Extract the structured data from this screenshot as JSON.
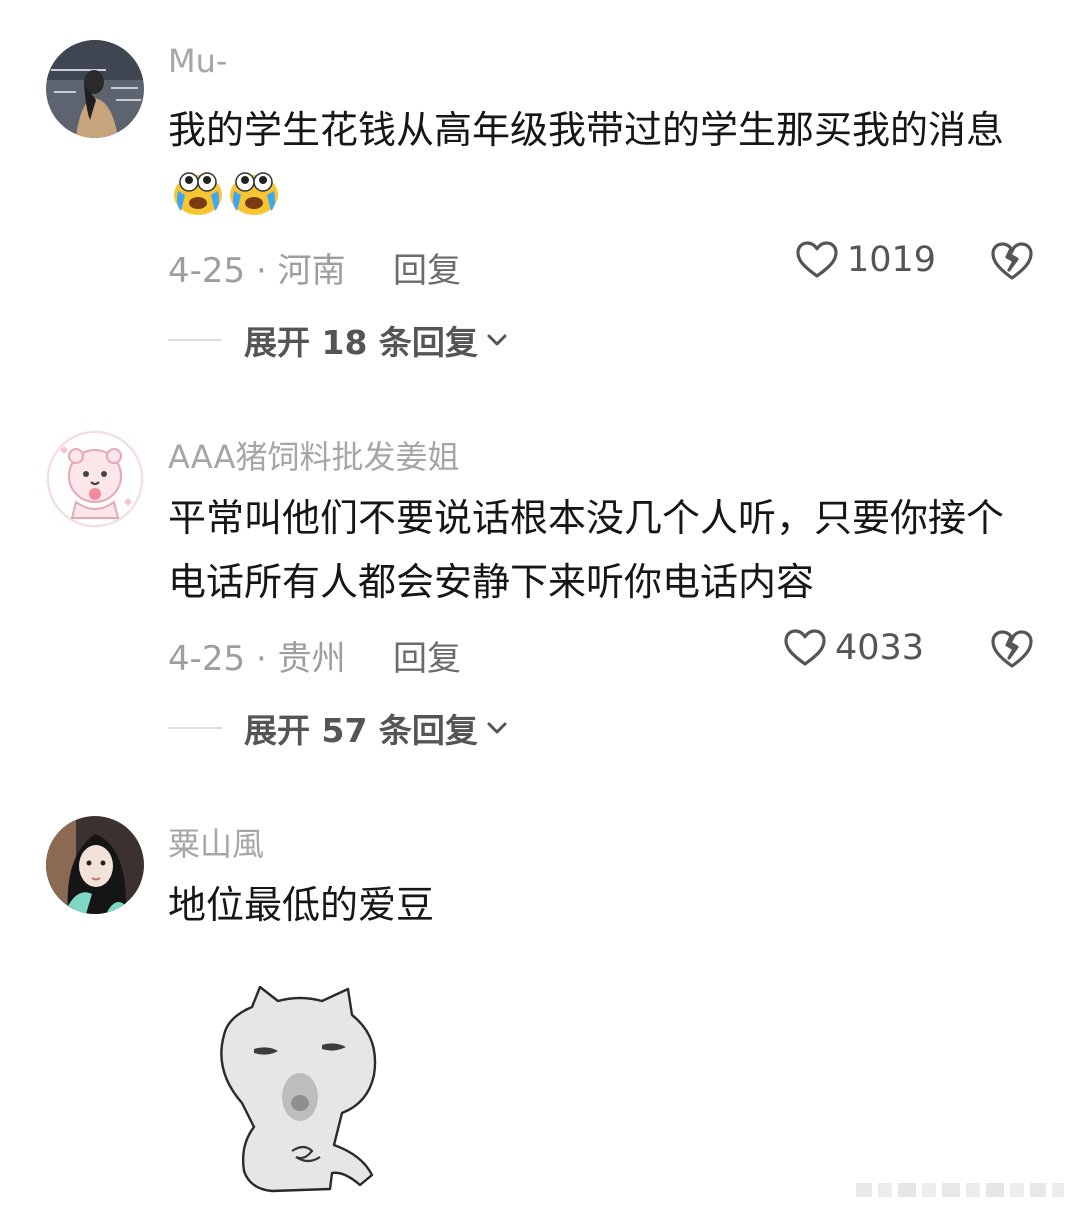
{
  "comments": [
    {
      "username": "Mu-",
      "text": "我的学生花钱从高年级我带过的学生那买我的消息",
      "emojis": [
        "crying-face-emoji",
        "crying-face-emoji"
      ],
      "date": "4-25",
      "location": "河南",
      "date_location": "4-25 · 河南",
      "reply_label": "回复",
      "likes": "1019",
      "expand_label": "展开 18 条回复"
    },
    {
      "username": "AAA猪饲料批发姜姐",
      "text": "平常叫他们不要说话根本没几个人听，只要你接个电话所有人都会安静下来听你电话内容",
      "date": "4-25",
      "location": "贵州",
      "date_location": "4-25 · 贵州",
      "reply_label": "回复",
      "likes": "4033",
      "expand_label": "展开 57 条回复"
    },
    {
      "username": "粟山風",
      "text": "地位最低的爱豆",
      "sticker": "grey-cat-meme-sticker"
    }
  ],
  "colors": {
    "username": "#a6a6a6",
    "text": "#161616",
    "meta": "#9e9e9e",
    "icon": "#555555"
  }
}
